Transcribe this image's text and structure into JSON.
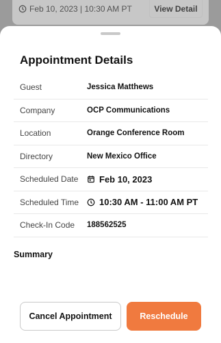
{
  "background_card": {
    "datetime": "Feb 10, 2023 | 10:30 AM PT",
    "view_detail_label": "View Detail"
  },
  "sheet": {
    "title": "Appointment Details",
    "rows": [
      {
        "label": "Guest",
        "value": "Jessica Matthews"
      },
      {
        "label": "Company",
        "value": "OCP Communications"
      },
      {
        "label": "Location",
        "value": "Orange Conference Room"
      },
      {
        "label": "Directory",
        "value": "New Mexico Office"
      },
      {
        "label": "Scheduled Date",
        "value": "Feb 10, 2023",
        "icon": "calendar-icon"
      },
      {
        "label": "Scheduled Time",
        "value": "10:30 AM - 11:00 AM PT",
        "icon": "clock-icon"
      },
      {
        "label": "Check-In Code",
        "value": "188562525"
      }
    ],
    "summary_heading": "Summary",
    "cancel_label": "Cancel Appointment",
    "reschedule_label": "Reschedule"
  },
  "colors": {
    "accent": "#f07a3f",
    "overlay": "#9b9b9b",
    "divider": "#e8e8e8"
  }
}
